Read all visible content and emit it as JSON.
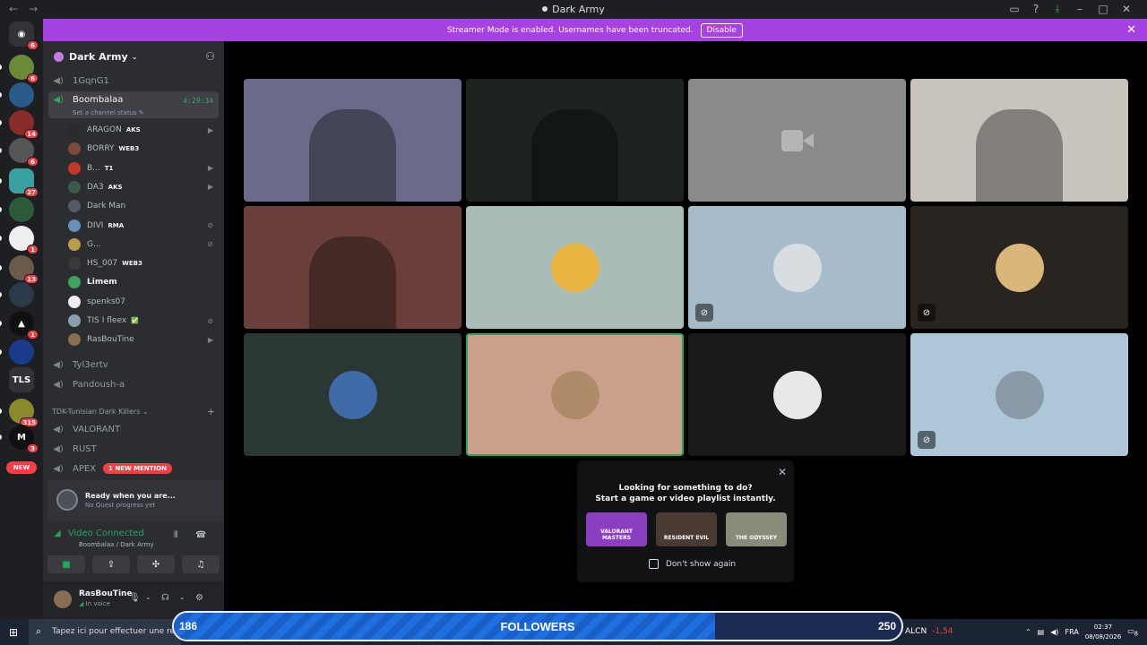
{
  "window": {
    "title": "Dark Army",
    "nav_back": "←",
    "nav_forward": "→"
  },
  "banner": {
    "text": "Streamer Mode is enabled. Usernames have been truncated.",
    "button": "Disable"
  },
  "rail": {
    "badges": [
      "6",
      "6",
      "14",
      "6",
      "27",
      "1",
      "13",
      "1",
      "315",
      "3"
    ],
    "tls_label": "TLS",
    "new_label": "NEW"
  },
  "server": {
    "name": "Dark Army"
  },
  "channels": {
    "top": "1GqnG1",
    "active": {
      "name": "Boombalaa",
      "timer": "4:29:34",
      "status": "Set a channel status"
    },
    "after": [
      "Tyl3ertv",
      "Pandoush-a"
    ],
    "category": "TDK-Tunisian Dark Killers",
    "category_channels": [
      "VALORANT",
      "RUST",
      "APEX"
    ],
    "mention": "1 NEW MENTION"
  },
  "voice_users": [
    {
      "name": "ARAGON",
      "tag": "AKS",
      "color": "#2a2a2a"
    },
    {
      "name": "BORRY",
      "tag": "WEB3",
      "color": "#7a4b3a"
    },
    {
      "name": "B...",
      "tag": "T1",
      "color": "#c0392b"
    },
    {
      "name": "DA3",
      "tag": "AKS",
      "color": "#3c5a4a"
    },
    {
      "name": "Dark Man",
      "tag": "",
      "color": "#555a66"
    },
    {
      "name": "DIVI",
      "tag": "RMA",
      "color": "#6a8fb8"
    },
    {
      "name": "G...",
      "tag": "",
      "color": "#b89e4a"
    },
    {
      "name": "HS_007",
      "tag": "WEB3",
      "color": "#3a3a3a"
    },
    {
      "name": "Limem",
      "tag": "",
      "color": "#3ba55d"
    },
    {
      "name": "spenks07",
      "tag": "",
      "color": "#eeeeee"
    },
    {
      "name": "TIS I fleex",
      "tag": "✅",
      "color": "#8aa0b0"
    },
    {
      "name": "RasBouTine",
      "tag": "",
      "color": "#8a6e52"
    }
  ],
  "quest": {
    "title": "Ready when you are...",
    "subtitle": "No Quest progress yet"
  },
  "voice": {
    "status": "Video Connected",
    "location": "Boombalaa / Dark Army"
  },
  "me": {
    "name": "RasBouTine",
    "status": "In voice"
  },
  "tiles": [
    {
      "bg": "#6b6a8a",
      "kind": "video"
    },
    {
      "bg": "#1d2420",
      "kind": "video"
    },
    {
      "bg": "#8a8a88",
      "kind": "cam-off"
    },
    {
      "bg": "#c8c4bc",
      "kind": "video"
    },
    {
      "bg": "#6a3f3a",
      "kind": "video"
    },
    {
      "bg": "#a9bcb8",
      "kind": "avatar",
      "avatar": "#e8b640"
    },
    {
      "bg": "#a6bccb",
      "kind": "avatar",
      "avatar": "#d8dde2",
      "muted": true
    },
    {
      "bg": "#2a2420",
      "kind": "avatar",
      "avatar": "#d9b77a",
      "muted": true
    },
    {
      "bg": "#2b3732",
      "kind": "avatar",
      "avatar": "#3e6aa8"
    },
    {
      "bg": "#c9a18a",
      "kind": "avatar",
      "avatar": "#b08b6a",
      "speaking": true
    },
    {
      "bg": "#1a1a1a",
      "kind": "avatar",
      "avatar": "#e8e8e8"
    },
    {
      "bg": "#adc7d8",
      "kind": "avatar",
      "avatar": "#8a9aa8",
      "muted": true
    }
  ],
  "activity": {
    "line1": "Looking for something to do?",
    "line2": "Start a game or video playlist instantly.",
    "games": [
      {
        "label": "VALORANT MASTERS",
        "bg": "#8a3fc0"
      },
      {
        "label": "RESIDENT EVIL",
        "bg": "#4a3a34"
      },
      {
        "label": "THE ODYSSEY",
        "bg": "#8a8a7a"
      }
    ],
    "checkbox": "Don't show again"
  },
  "taskbar": {
    "search_placeholder": "Tapez ici pour effectuer une re",
    "ticker": "ALCN",
    "ticker_change": "-1,54",
    "lang": "FRA",
    "time": "02:37",
    "date": "08/08/2026",
    "notif": "8"
  },
  "followers": {
    "label": "FOLLOWERS",
    "current": "186",
    "goal": "250",
    "progress": 0.744
  }
}
